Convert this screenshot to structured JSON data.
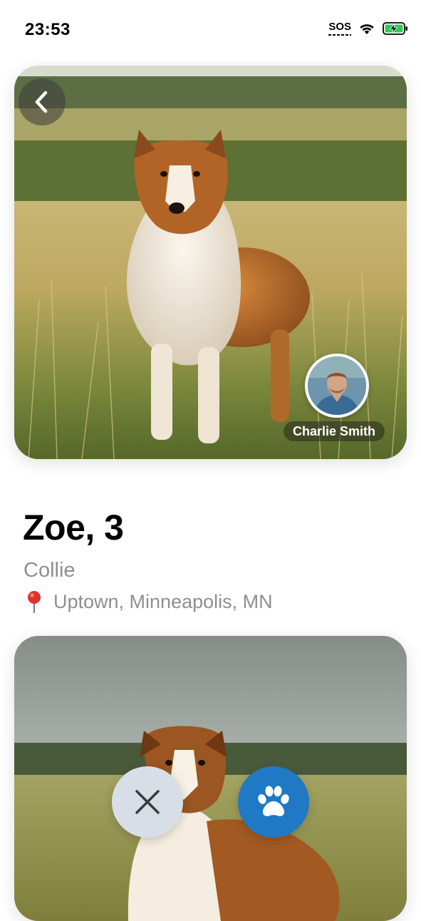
{
  "status_bar": {
    "time": "23:53",
    "sos": "SOS",
    "icons": [
      "sos-indicator",
      "wifi-icon",
      "battery-charging-icon"
    ]
  },
  "profile": {
    "name_age": "Zoe, 3",
    "breed": "Collie",
    "location": "Uptown, Minneapolis, MN",
    "location_icon": "pin-icon"
  },
  "owner": {
    "name": "Charlie Smith"
  },
  "actions": {
    "dislike_icon": "close-icon",
    "like_icon": "paw-icon"
  },
  "colors": {
    "like_button": "#1f79c4",
    "dislike_button": "#d8dee6",
    "secondary_text": "#8e8e93",
    "pin": "#e0322e"
  }
}
